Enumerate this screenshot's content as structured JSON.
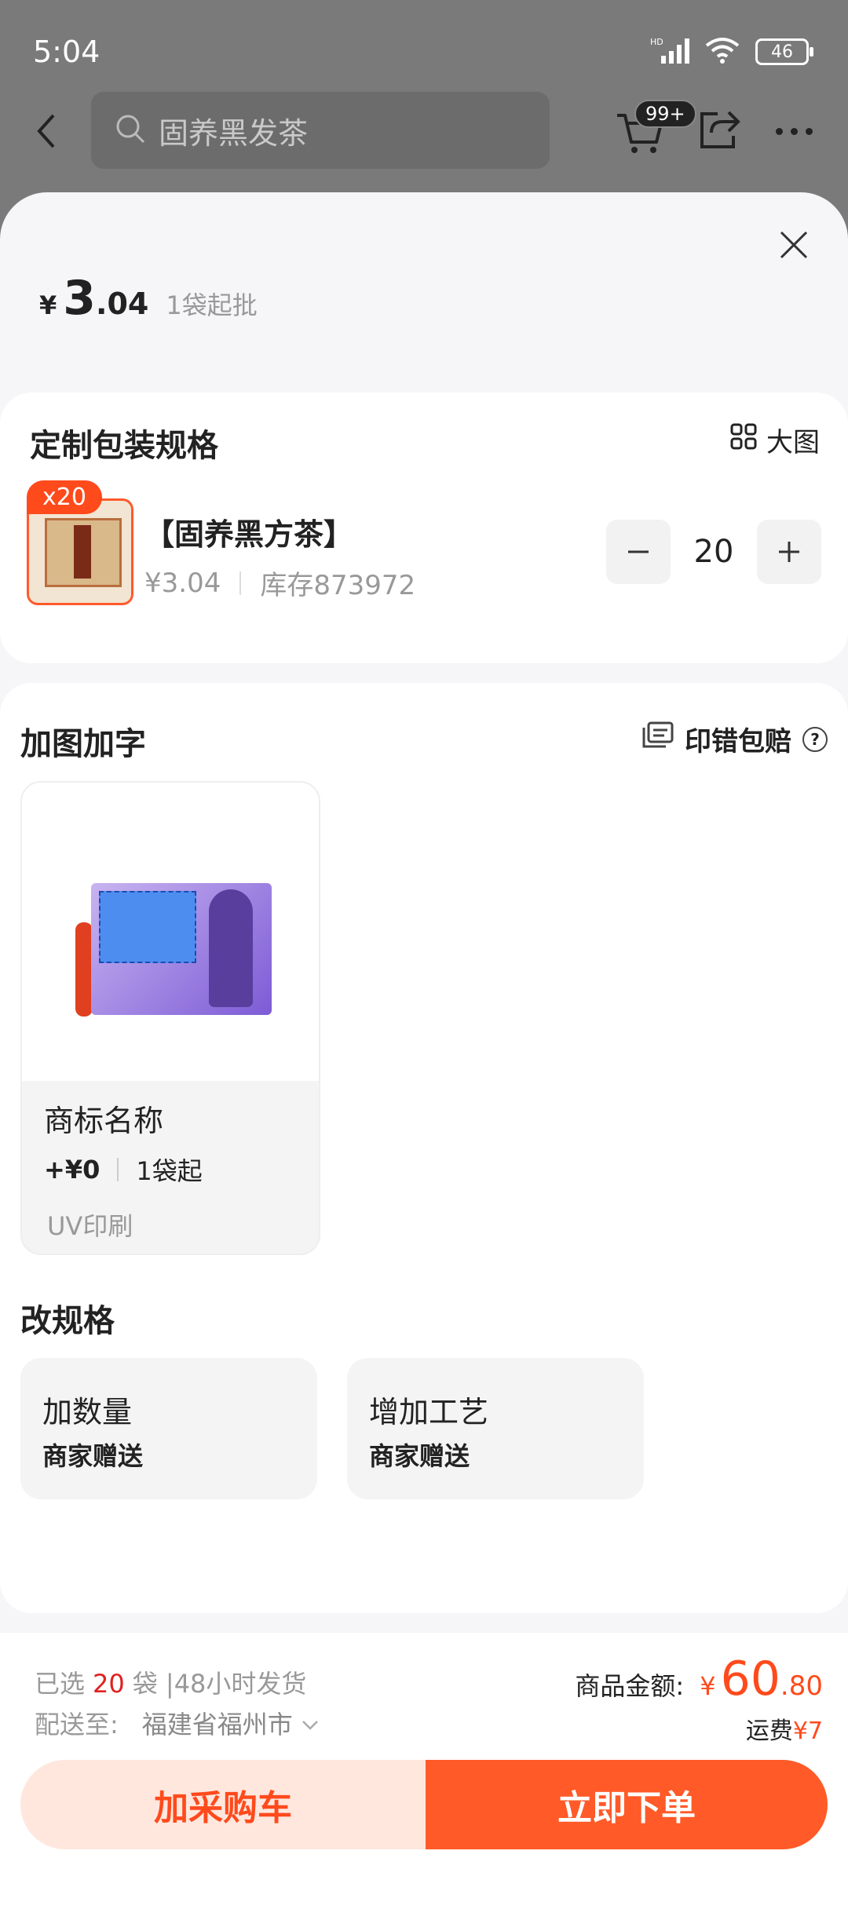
{
  "status": {
    "time": "5:04",
    "battery": "46",
    "signal_label": "HD"
  },
  "header": {
    "search_placeholder": "固养黑发茶",
    "cart_badge": "99+"
  },
  "price": {
    "currency": "¥",
    "integer": "3",
    "decimal": ".04",
    "min_order": "1袋起批"
  },
  "spec_section": {
    "title": "定制包装规格",
    "big_view_label": "大图",
    "item": {
      "badge": "x20",
      "name": "【固养黑方茶】",
      "price": "¥3.04",
      "stock": "库存873972",
      "quantity": "20"
    }
  },
  "customize_section": {
    "title": "加图加字",
    "guarantee_label": "印错包赔",
    "option": {
      "name": "商标名称",
      "price": "+¥0",
      "min": "1袋起",
      "tech": "UV印刷"
    }
  },
  "change_spec": {
    "title": "改规格",
    "cards": [
      {
        "name": "加数量",
        "sub": "商家赠送"
      },
      {
        "name": "增加工艺",
        "sub": "商家赠送"
      }
    ]
  },
  "footer": {
    "selected_prefix": "已选",
    "selected_count": "20",
    "selected_suffix": "袋 |48小时发货",
    "ship_label": "配送至:",
    "ship_address": "福建省福州市",
    "total_label": "商品金额:",
    "total_currency": "¥",
    "total_integer": "60",
    "total_decimal": ".80",
    "freight_label": "运费",
    "freight_value": "¥7",
    "add_cart": "加采购车",
    "buy_now": "立即下单"
  },
  "colors": {
    "accent": "#ff5a28",
    "accent_light": "#ffe7de",
    "price_red": "#e02020"
  }
}
